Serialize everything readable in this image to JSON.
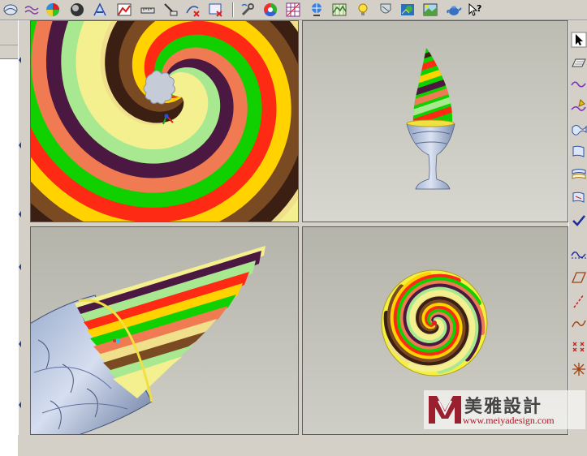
{
  "toolbar": {
    "icons": [
      "surface-analysis-icon",
      "curve-icon",
      "color-sphere-icon",
      "shading-icon",
      "text-icon",
      "color-map-icon",
      "measure-icon",
      "measure-x-icon",
      "delete-curve-icon",
      "delete-surface-icon",
      "tools-icon",
      "color-wheel-icon",
      "grid-icon",
      "globe-icon",
      "terrain-icon",
      "light-bulb-icon",
      "shield-icon",
      "map-icon",
      "landscape-icon",
      "teapot-icon",
      "help-pointer-icon"
    ],
    "help_label": "?"
  },
  "viewports": {
    "top_left": {
      "view": "top-view"
    },
    "top_right": {
      "view": "perspective-view"
    },
    "bottom_left": {
      "view": "closeup-view"
    },
    "bottom_right": {
      "view": "bottom-view"
    }
  },
  "spiral_colors": [
    "#f0e08c",
    "#3a1f12",
    "#7a4a22",
    "#ffd200",
    "#ff2a14",
    "#10d000",
    "#f07a52",
    "#4a1840",
    "#a8e890",
    "#f4f090"
  ],
  "right_toolbar": {
    "icons": [
      "pointer-icon",
      "plane-icon",
      "wave-curve-icon",
      "pen-curve-icon",
      "surface-wave-icon",
      "surface-flag-icon",
      "surface-stack-icon",
      "surface-flip-icon",
      "checkmark-icon",
      "wave-line-icon",
      "parallelogram-icon",
      "dashed-line-icon",
      "s-curve-icon",
      "cross-points-icon",
      "star-point-icon"
    ]
  },
  "watermark": {
    "name": "美雅設計",
    "url": "www.meiyadesign.com"
  }
}
